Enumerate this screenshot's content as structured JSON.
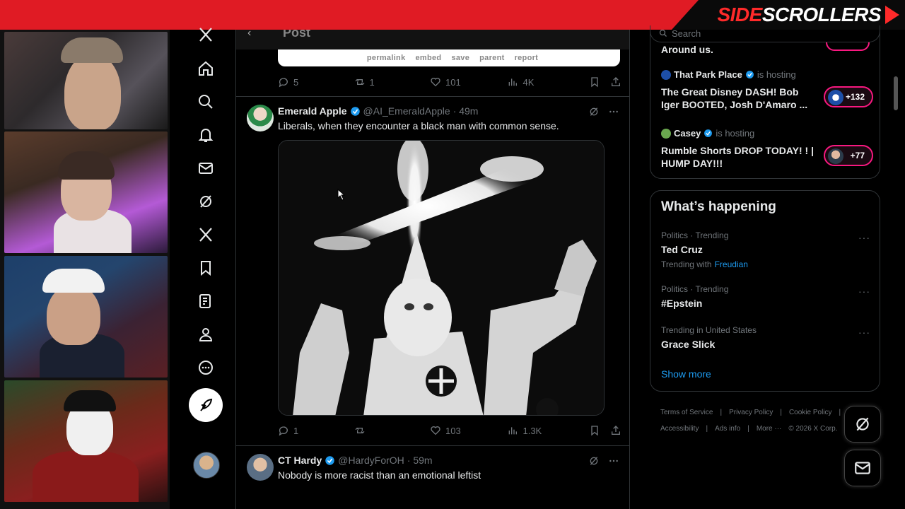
{
  "brand": {
    "part1": "SIDE",
    "part2": "SCROLLERS"
  },
  "header": {
    "title": "Post"
  },
  "embed_links": [
    "permalink",
    "embed",
    "save",
    "parent",
    "report"
  ],
  "post0_stats": {
    "replies": "5",
    "reposts": "1",
    "likes": "101",
    "views": "4K"
  },
  "tweet1": {
    "name": "Emerald Apple",
    "handle": "@AI_EmeraldApple",
    "time": "· 49m",
    "text": "Liberals, when they encounter a black man with common sense.",
    "stats": {
      "replies": "1",
      "reposts": "",
      "likes": "103",
      "views": "1.3K"
    }
  },
  "tweet2": {
    "name": "CT Hardy",
    "handle": "@HardyForOH",
    "time": "· 59m",
    "text": "Nobody is more racist than an emotional leftist"
  },
  "search": {
    "placeholder": "Search"
  },
  "spaces": {
    "cut_title": "Around us.",
    "items": [
      {
        "host": "That Park Place",
        "suffix": "is hosting",
        "title": "The Great Disney DASH! Bob Iger BOOTED, Josh D'Amaro ...",
        "count": "+132"
      },
      {
        "host": "Casey",
        "suffix": "is hosting",
        "title": "Rumble Shorts DROP TODAY! ! | HUMP DAY!!!",
        "count": "+77"
      }
    ]
  },
  "happening": {
    "title": "What’s happening",
    "trends": [
      {
        "meta": "Politics · Trending",
        "topic": "Ted Cruz",
        "with_label": "Trending with",
        "with_link": "Freudian"
      },
      {
        "meta": "Politics · Trending",
        "topic": "#Epstein"
      },
      {
        "meta": "Trending in United States",
        "topic": "Grace Slick"
      }
    ],
    "show_more": "Show more"
  },
  "footer": {
    "links": [
      "Terms of Service",
      "|",
      "Privacy Policy",
      "|",
      "Cookie Policy",
      "|",
      "Accessibility",
      "|",
      "Ads info",
      "|",
      "More ···",
      "© 2026 X Corp."
    ]
  },
  "icons": {
    "nav": [
      "x-logo-icon",
      "home-icon",
      "search-icon",
      "notifications-icon",
      "messages-icon",
      "grok-icon",
      "x-premium-icon",
      "bookmarks-icon",
      "lists-icon",
      "profile-icon",
      "more-icon"
    ]
  },
  "colors": {
    "brand_red": "#e01b24",
    "x_blue": "#1d9bf0",
    "spaces_pink": "#f91880"
  }
}
